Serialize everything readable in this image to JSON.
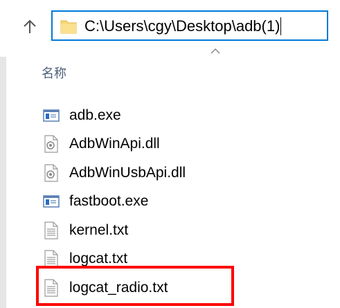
{
  "address_bar": {
    "path": "C:\\Users\\cgy\\Desktop\\adb(1)",
    "folder_icon": "folder-icon",
    "up_icon": "up-arrow-icon"
  },
  "column_header": {
    "name": "名称",
    "sort_icon": "chevron-up-icon"
  },
  "files": [
    {
      "name": "adb.exe",
      "icon": "exe-icon"
    },
    {
      "name": "AdbWinApi.dll",
      "icon": "dll-icon"
    },
    {
      "name": "AdbWinUsbApi.dll",
      "icon": "dll-icon"
    },
    {
      "name": "fastboot.exe",
      "icon": "exe-icon"
    },
    {
      "name": "kernel.txt",
      "icon": "txt-icon"
    },
    {
      "name": "logcat.txt",
      "icon": "txt-icon"
    },
    {
      "name": "logcat_radio.txt",
      "icon": "txt-icon"
    }
  ],
  "colors": {
    "address_border": "#0078d7",
    "highlight": "#ff0000",
    "header_text": "#4c607a"
  }
}
